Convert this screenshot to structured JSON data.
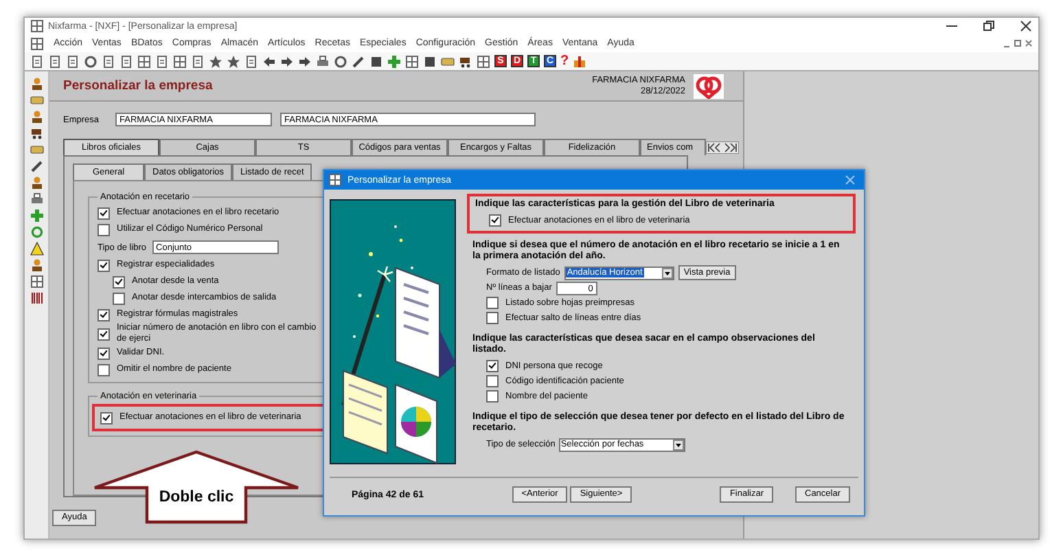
{
  "window": {
    "title": "Nixfarma - [NXF] - [Personalizar la empresa]"
  },
  "menu": [
    "Acción",
    "Ventas",
    "BDatos",
    "Compras",
    "Almacén",
    "Artículos",
    "Recetas",
    "Especiales",
    "Configuración",
    "Gestión",
    "Áreas",
    "Ventana",
    "Ayuda"
  ],
  "toolbar": {
    "letter_buttons": [
      {
        "label": "S",
        "color": "#e01b1b"
      },
      {
        "label": "D",
        "color": "#e01b1b"
      },
      {
        "label": "T",
        "color": "#1f9a2e"
      },
      {
        "label": "C",
        "color": "#1f5bd6"
      }
    ],
    "help": "?"
  },
  "panel": {
    "title": "Personalizar la empresa",
    "company": "FARMACIA NIXFARMA",
    "date": "28/12/2022"
  },
  "empresa": {
    "label": "Empresa",
    "code": "FARMACIA NIXFARMA",
    "name": "FARMACIA NIXFARMA"
  },
  "tabs": [
    {
      "label": "Libros oficiales",
      "selected": true
    },
    {
      "label": "Cajas",
      "selected": false
    },
    {
      "label": "TS",
      "selected": false
    },
    {
      "label": "Códigos para ventas",
      "selected": false
    },
    {
      "label": "Encargos y Faltas",
      "selected": false
    },
    {
      "label": "Fidelización",
      "selected": false
    },
    {
      "label": "Envios com",
      "selected": false
    }
  ],
  "subtabs": [
    {
      "label": "General",
      "selected": true
    },
    {
      "label": "Datos obligatorios",
      "selected": false
    },
    {
      "label": "Listado de recet",
      "selected": false
    }
  ],
  "groups": [
    {
      "title": "Anotación en recetario",
      "highlighted": false,
      "items": [
        {
          "kind": "checkbox",
          "label": "Efectuar anotaciones en el libro recetario",
          "checked": true
        },
        {
          "kind": "checkbox",
          "label": "Utilizar el Código Numérico Personal",
          "checked": false
        },
        {
          "kind": "field",
          "label": "Tipo de libro",
          "value": "Conjunto"
        },
        {
          "kind": "checkbox",
          "label": "Registrar especialidades",
          "checked": true,
          "children": [
            {
              "kind": "checkbox",
              "label": "Anotar desde la venta",
              "checked": true
            },
            {
              "kind": "checkbox",
              "label": "Anotar desde intercambios de salida",
              "checked": false
            }
          ]
        },
        {
          "kind": "checkbox",
          "label": "Registrar fórmulas magistrales",
          "checked": true
        },
        {
          "kind": "checkbox",
          "label": "Iniciar número de anotación en libro con el cambio de ejerci",
          "checked": true
        },
        {
          "kind": "checkbox",
          "label": "Validar DNI.",
          "checked": true
        },
        {
          "kind": "checkbox",
          "label": "Omitir el nombre de paciente",
          "checked": false
        }
      ]
    },
    {
      "title": "Anotación en veterinaria",
      "highlighted": true,
      "items": [
        {
          "kind": "checkbox",
          "label": "Efectuar anotaciones en el libro de veterinaria",
          "checked": true
        }
      ]
    }
  ],
  "help_button": "Ayuda",
  "callout": {
    "text": "Doble clic"
  },
  "dialog": {
    "title": "Personalizar la empresa",
    "sections": [
      {
        "heading": "Indique las características para la gestión del Libro de veterinaria",
        "highlighted": true,
        "items": [
          {
            "kind": "checkbox",
            "label": "Efectuar anotaciones en el libro de veterinaria",
            "checked": true
          }
        ]
      },
      {
        "heading": "Indique si desea que el número de anotación en el libro recetario se inicie a 1 en la primera anotación del año.",
        "highlighted": false,
        "items": [
          {
            "kind": "select",
            "label": "Formato de listado",
            "value": "Andalucía Horizont",
            "button": "Vista previa"
          },
          {
            "kind": "field",
            "label": "Nº líneas a bajar",
            "value": "0"
          },
          {
            "kind": "checkbox",
            "label": "Listado sobre hojas preimpresas",
            "checked": false
          },
          {
            "kind": "checkbox",
            "label": "Efectuar salto de líneas entre días",
            "checked": false
          }
        ]
      },
      {
        "heading": "Indique las características que desea sacar en el campo observaciones del listado.",
        "highlighted": false,
        "items": [
          {
            "kind": "checkbox",
            "label": "DNI persona que recoge",
            "checked": true
          },
          {
            "kind": "checkbox",
            "label": "Código identificación paciente",
            "checked": false
          },
          {
            "kind": "checkbox",
            "label": "Nombre del paciente",
            "checked": false
          }
        ]
      },
      {
        "heading": "Indique el tipo de selección que desea tener por defecto en el listado del Libro de recetario.",
        "highlighted": false,
        "items": [
          {
            "kind": "select",
            "label": "Tipo de selección",
            "value": "Selección por fechas"
          }
        ]
      }
    ],
    "page": "Página 42 de 61",
    "buttons": [
      "<Anterior",
      "Siguiente>",
      "Finalizar",
      "Cancelar"
    ]
  }
}
